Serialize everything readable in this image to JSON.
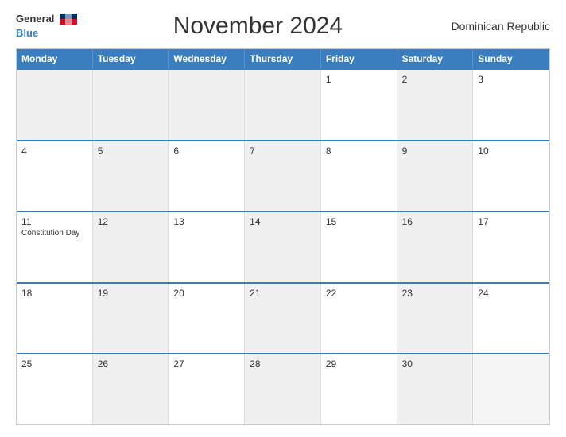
{
  "header": {
    "logo_general": "General",
    "logo_blue": "Blue",
    "title": "November 2024",
    "country": "Dominican Republic"
  },
  "days_of_week": [
    "Monday",
    "Tuesday",
    "Wednesday",
    "Thursday",
    "Friday",
    "Saturday",
    "Sunday"
  ],
  "weeks": [
    [
      {
        "day": "",
        "holiday": "",
        "shaded": true
      },
      {
        "day": "",
        "holiday": "",
        "shaded": true
      },
      {
        "day": "",
        "holiday": "",
        "shaded": true
      },
      {
        "day": "",
        "holiday": "",
        "shaded": true
      },
      {
        "day": "1",
        "holiday": "",
        "shaded": false
      },
      {
        "day": "2",
        "holiday": "",
        "shaded": true
      },
      {
        "day": "3",
        "holiday": "",
        "shaded": false
      }
    ],
    [
      {
        "day": "4",
        "holiday": "",
        "shaded": false
      },
      {
        "day": "5",
        "holiday": "",
        "shaded": true
      },
      {
        "day": "6",
        "holiday": "",
        "shaded": false
      },
      {
        "day": "7",
        "holiday": "",
        "shaded": true
      },
      {
        "day": "8",
        "holiday": "",
        "shaded": false
      },
      {
        "day": "9",
        "holiday": "",
        "shaded": true
      },
      {
        "day": "10",
        "holiday": "",
        "shaded": false
      }
    ],
    [
      {
        "day": "11",
        "holiday": "Constitution Day",
        "shaded": false
      },
      {
        "day": "12",
        "holiday": "",
        "shaded": true
      },
      {
        "day": "13",
        "holiday": "",
        "shaded": false
      },
      {
        "day": "14",
        "holiday": "",
        "shaded": true
      },
      {
        "day": "15",
        "holiday": "",
        "shaded": false
      },
      {
        "day": "16",
        "holiday": "",
        "shaded": true
      },
      {
        "day": "17",
        "holiday": "",
        "shaded": false
      }
    ],
    [
      {
        "day": "18",
        "holiday": "",
        "shaded": false
      },
      {
        "day": "19",
        "holiday": "",
        "shaded": true
      },
      {
        "day": "20",
        "holiday": "",
        "shaded": false
      },
      {
        "day": "21",
        "holiday": "",
        "shaded": true
      },
      {
        "day": "22",
        "holiday": "",
        "shaded": false
      },
      {
        "day": "23",
        "holiday": "",
        "shaded": true
      },
      {
        "day": "24",
        "holiday": "",
        "shaded": false
      }
    ],
    [
      {
        "day": "25",
        "holiday": "",
        "shaded": false
      },
      {
        "day": "26",
        "holiday": "",
        "shaded": true
      },
      {
        "day": "27",
        "holiday": "",
        "shaded": false
      },
      {
        "day": "28",
        "holiday": "",
        "shaded": true
      },
      {
        "day": "29",
        "holiday": "",
        "shaded": false
      },
      {
        "day": "30",
        "holiday": "",
        "shaded": true
      },
      {
        "day": "",
        "holiday": "",
        "shaded": false
      }
    ]
  ]
}
